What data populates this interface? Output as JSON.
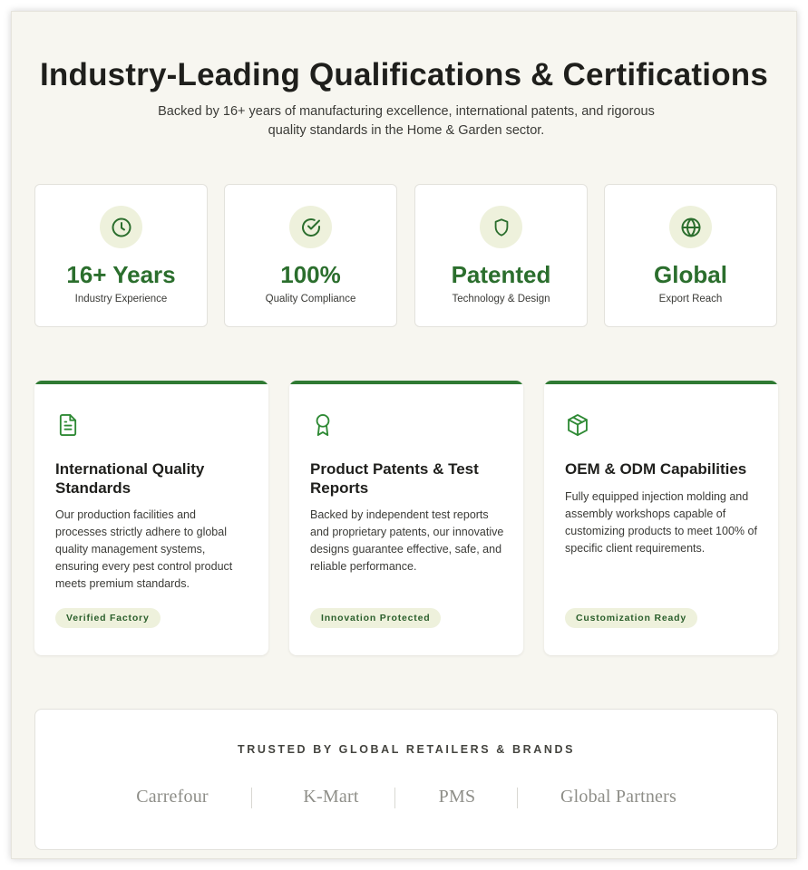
{
  "header": {
    "title": "Industry-Leading Qualifications & Certifications",
    "subtitle": "Backed by 16+ years of manufacturing excellence, international patents, and rigorous quality standards in the Home & Garden sector."
  },
  "stats": [
    {
      "icon": "clock-icon",
      "value": "16+ Years",
      "label": "Industry Experience"
    },
    {
      "icon": "check-circle-icon",
      "value": "100%",
      "label": "Quality Compliance"
    },
    {
      "icon": "shield-icon",
      "value": "Patented",
      "label": "Technology & Design"
    },
    {
      "icon": "globe-icon",
      "value": "Global",
      "label": "Export Reach"
    }
  ],
  "features": [
    {
      "icon": "document-icon",
      "title": "International Quality Standards",
      "description": "Our production facilities and processes strictly adhere to global quality management systems, ensuring every pest control product meets premium standards.",
      "badge": "Verified Factory"
    },
    {
      "icon": "award-ribbon-icon",
      "title": "Product Patents & Test Reports",
      "description": "Backed by independent test reports and proprietary patents, our innovative designs guarantee effective, safe, and reliable performance.",
      "badge": "Innovation Protected"
    },
    {
      "icon": "box-icon",
      "title": "OEM & ODM Capabilities",
      "description": "Fully equipped injection molding and assembly workshops capable of customizing products to meet 100% of specific client requirements.",
      "badge": "Customization Ready"
    }
  ],
  "trusted": {
    "heading": "TRUSTED BY GLOBAL RETAILERS & BRANDS",
    "logos": [
      "Carrefour",
      "K-Mart",
      "PMS",
      "Global Partners"
    ]
  },
  "colors": {
    "accent_green": "#2b6e2d",
    "bar_green": "#2f7a33",
    "icon_bg": "#eef1dc",
    "page_bg": "#f7f6f0"
  }
}
